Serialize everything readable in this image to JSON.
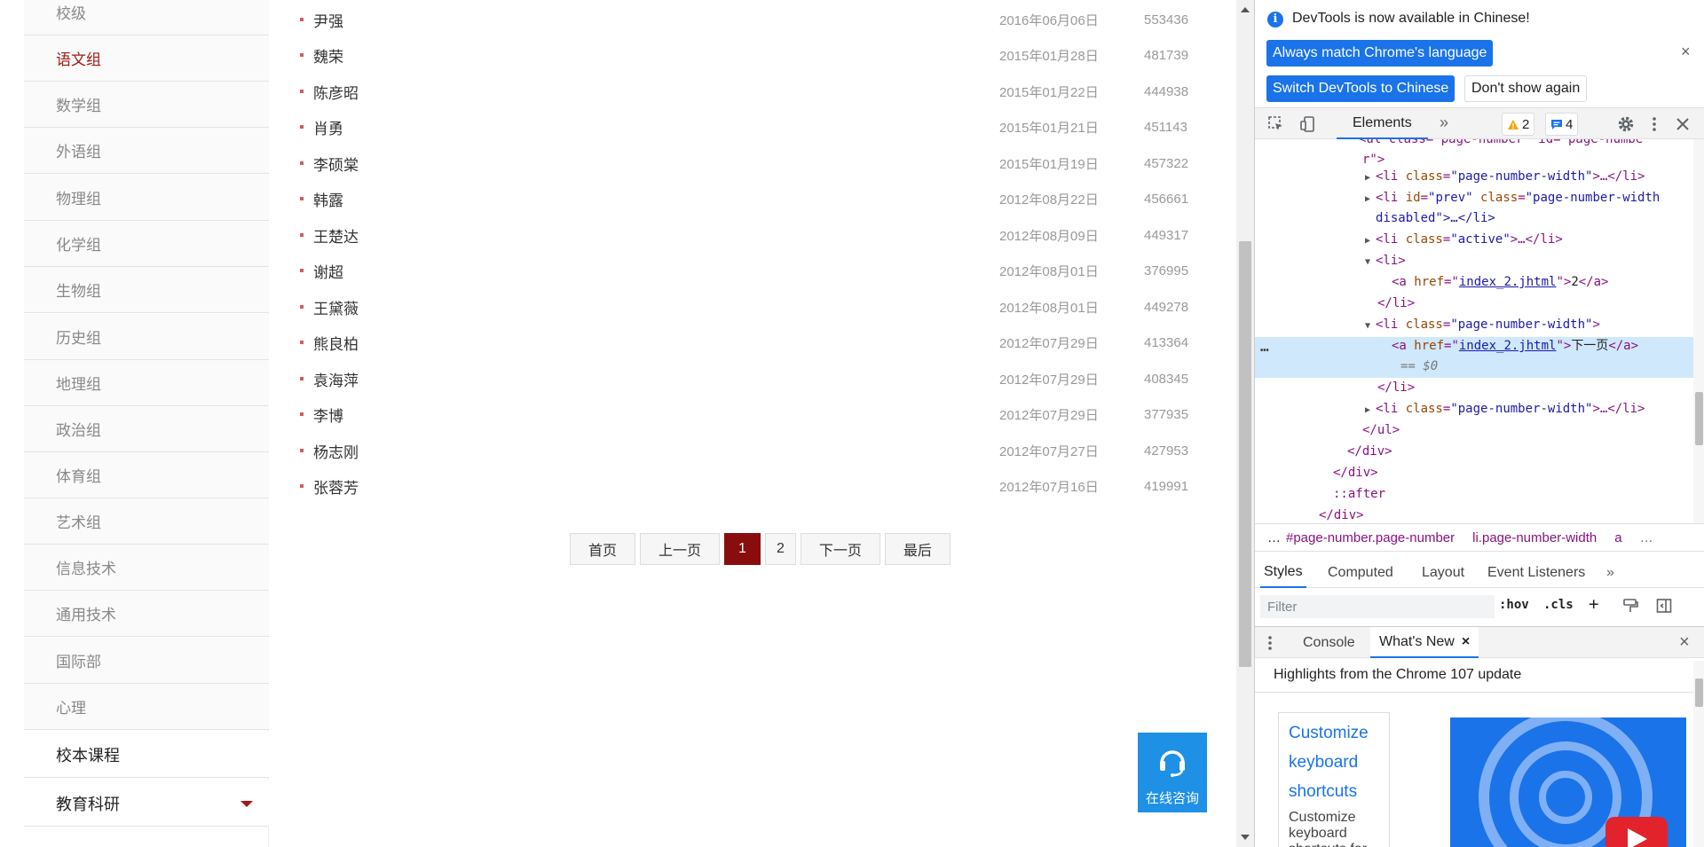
{
  "sidebar": {
    "items": [
      {
        "label": "校级",
        "state": "normal"
      },
      {
        "label": "语文组",
        "state": "active"
      },
      {
        "label": "数学组",
        "state": "normal"
      },
      {
        "label": "外语组",
        "state": "normal"
      },
      {
        "label": "物理组",
        "state": "normal"
      },
      {
        "label": "化学组",
        "state": "normal"
      },
      {
        "label": "生物组",
        "state": "normal"
      },
      {
        "label": "历史组",
        "state": "normal"
      },
      {
        "label": "地理组",
        "state": "normal"
      },
      {
        "label": "政治组",
        "state": "normal"
      },
      {
        "label": "体育组",
        "state": "normal"
      },
      {
        "label": "艺术组",
        "state": "normal"
      },
      {
        "label": "信息技术",
        "state": "normal"
      },
      {
        "label": "通用技术",
        "state": "normal"
      },
      {
        "label": "国际部",
        "state": "normal"
      },
      {
        "label": "心理",
        "state": "normal"
      },
      {
        "label": "校本课程",
        "state": "main"
      },
      {
        "label": "教育科研",
        "state": "main",
        "expand_icon": "triangle-down-icon"
      }
    ]
  },
  "articles": [
    {
      "name": "尹强",
      "date": "2016年06月06日",
      "count": "553436"
    },
    {
      "name": "魏荣",
      "date": "2015年01月28日",
      "count": "481739"
    },
    {
      "name": "陈彦昭",
      "date": "2015年01月22日",
      "count": "444938"
    },
    {
      "name": "肖勇",
      "date": "2015年01月21日",
      "count": "451143"
    },
    {
      "name": "李硕棠",
      "date": "2015年01月19日",
      "count": "457322"
    },
    {
      "name": "韩露",
      "date": "2012年08月22日",
      "count": "456661"
    },
    {
      "name": "王楚达",
      "date": "2012年08月09日",
      "count": "449317"
    },
    {
      "name": "谢超",
      "date": "2012年08月01日",
      "count": "376995"
    },
    {
      "name": "王黛薇",
      "date": "2012年08月01日",
      "count": "449278"
    },
    {
      "name": "熊良柏",
      "date": "2012年07月29日",
      "count": "413364"
    },
    {
      "name": "袁海萍",
      "date": "2012年07月29日",
      "count": "408345"
    },
    {
      "name": "李博",
      "date": "2012年07月29日",
      "count": "377935"
    },
    {
      "name": "杨志刚",
      "date": "2012年07月27日",
      "count": "427953"
    },
    {
      "name": "张蓉芳",
      "date": "2012年07月16日",
      "count": "419991"
    }
  ],
  "pager": {
    "first": "首页",
    "prev": "上一页",
    "current": "1",
    "page2": "2",
    "next": "下一页",
    "last": "最后"
  },
  "consult": {
    "label": "在线咨询",
    "icon": "headset-icon"
  },
  "devtools": {
    "notice": {
      "text": "DevTools is now available in Chinese!",
      "match_btn": "Always match Chrome's language",
      "switch_btn": "Switch DevTools to Chinese",
      "dismiss_btn": "Don't show again",
      "close": "×"
    },
    "toolbar": {
      "elements_tab": "Elements",
      "more": "»",
      "warnings": "2",
      "messages": "4"
    },
    "dom_lines": {
      "l0": "<ul class=\"page-number\" id=\"page-numbe",
      "l1": "r\">",
      "l2_tag": "<li ",
      "l2_att": "class",
      "l2_val": "\"page-number-width\"",
      "l2_end": ">…</li>",
      "l3_att1": "id",
      "l3_val1": "\"prev\"",
      "l3_att2": "class",
      "l3_val2": "\"page-number-width",
      "l4": "disabled\">…</li>",
      "l5_att": "class",
      "l5_val": "\"active\"",
      "l5_end": ">…</li>",
      "l6": "<li>",
      "l7_att": "href",
      "l7_val": "index_2.jhtml",
      "l7_text": "2",
      "l8": "</li>",
      "l9_att": "class",
      "l9_val": "\"page-number-width\"",
      "l10_att": "href",
      "l10_val": "index_2.jhtml",
      "l10_text": "下一页",
      "l11": "== $0",
      "l12": "</li>",
      "l13_att": "class",
      "l13_val": "\"page-number-width\"",
      "l13_end": ">…</li>",
      "l14": "</ul>",
      "l15": "</div>",
      "l16": "</div>",
      "l17": "::after",
      "l18": "</div>"
    },
    "breadcrumbs": {
      "dots": "…",
      "c1": "#page-number.page-number",
      "c2": "li.page-number-width",
      "c3": "a",
      "more": "…"
    },
    "styles_tabs": {
      "styles": "Styles",
      "computed": "Computed",
      "layout": "Layout",
      "listeners": "Event Listeners",
      "more": "»"
    },
    "filter": {
      "placeholder": "Filter",
      "hov": ":hov",
      "cls": ".cls",
      "plus": "+"
    },
    "drawer": {
      "console": "Console",
      "whatsnew": "What's New",
      "tab_close": "×",
      "close": "×"
    },
    "whatsnew": {
      "title": "Highlights from the Chrome 107 update",
      "link": "Customize keyboard shortcuts",
      "desc": "Customize keyboard shortcuts for"
    }
  },
  "colors": {
    "accent_red": "#8a0d0d",
    "devtools_blue": "#1a73e8",
    "consult_blue": "#1e90e6"
  }
}
